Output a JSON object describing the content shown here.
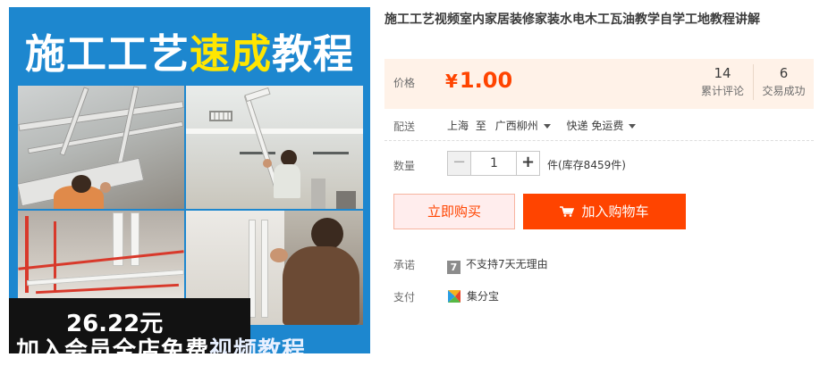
{
  "product_image": {
    "title_part1": "施工工艺",
    "title_highlight": "速成",
    "title_part2": "教程",
    "promo_price": "26.22元",
    "promo_text_main": "加入会员全店免费",
    "promo_text_tail": "视频教程"
  },
  "product": {
    "title": "施工工艺视频室内家居装修家装水电木工瓦油教学自学工地教程讲解"
  },
  "price_panel": {
    "label": "价格",
    "currency": "¥",
    "amount": "1.00",
    "reviews_count": "14",
    "reviews_label": "累计评论",
    "sales_count": "6",
    "sales_label": "交易成功"
  },
  "shipping": {
    "label": "配送",
    "origin": "上海",
    "to_word": "至",
    "destination": "广西柳州",
    "method": "快递 免运费"
  },
  "quantity": {
    "label": "数量",
    "minus": "−",
    "value": "1",
    "plus": "+",
    "stock_text": "件(库存8459件)"
  },
  "actions": {
    "buy_now": "立即购买",
    "add_to_cart": "加入购物车"
  },
  "promise": {
    "label": "承诺",
    "icon_text": "7",
    "text": "不支持7天无理由"
  },
  "payment": {
    "label": "支付",
    "method": "集分宝"
  },
  "colors": {
    "accent": "#ff4400",
    "price_bg": "#fff2e8",
    "image_bg": "#1d87cf",
    "highlight": "#ffe600"
  },
  "icons": {
    "cart": "cart-icon",
    "promise": "seven-day-icon",
    "payment": "jifenbao-icon",
    "dropdown": "chevron-down-icon"
  }
}
